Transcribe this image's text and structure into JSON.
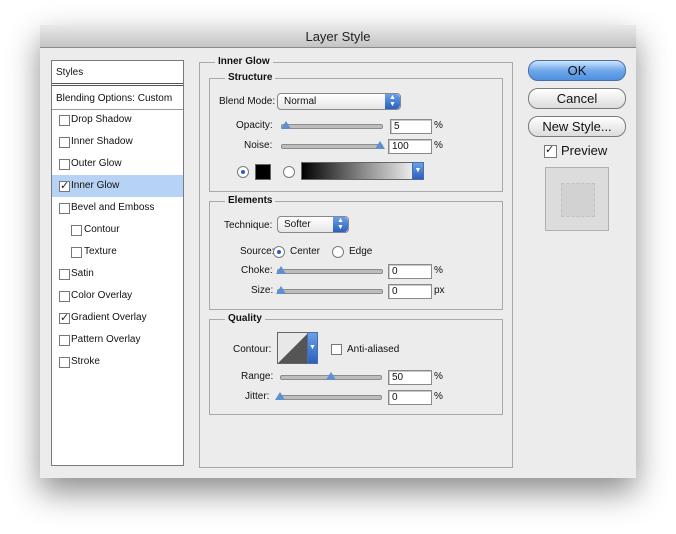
{
  "window": {
    "title": "Layer Style"
  },
  "sidebar": {
    "header": "Styles",
    "blending": "Blending Options: Custom",
    "items": [
      {
        "label": "Drop Shadow",
        "checked": false
      },
      {
        "label": "Inner Shadow",
        "checked": false
      },
      {
        "label": "Outer Glow",
        "checked": false
      },
      {
        "label": "Inner Glow",
        "checked": true,
        "selected": true
      },
      {
        "label": "Bevel and Emboss",
        "checked": false
      },
      {
        "label": "Contour",
        "checked": false
      },
      {
        "label": "Texture",
        "checked": false
      },
      {
        "label": "Satin",
        "checked": false
      },
      {
        "label": "Color Overlay",
        "checked": false
      },
      {
        "label": "Gradient Overlay",
        "checked": true
      },
      {
        "label": "Pattern Overlay",
        "checked": false
      },
      {
        "label": "Stroke",
        "checked": false
      }
    ]
  },
  "panel": {
    "title": "Inner Glow",
    "structure": {
      "title": "Structure",
      "blend_mode_label": "Blend Mode:",
      "blend_mode_value": "Normal",
      "opacity_label": "Opacity:",
      "opacity_value": "5",
      "opacity_unit": "%",
      "noise_label": "Noise:",
      "noise_value": "100",
      "noise_unit": "%",
      "color_swatch": "#000000",
      "color_mode": "solid"
    },
    "elements": {
      "title": "Elements",
      "technique_label": "Technique:",
      "technique_value": "Softer",
      "source_label": "Source:",
      "source_center": "Center",
      "source_edge": "Edge",
      "source_selected": "Center",
      "choke_label": "Choke:",
      "choke_value": "0",
      "choke_unit": "%",
      "size_label": "Size:",
      "size_value": "0",
      "size_unit": "px"
    },
    "quality": {
      "title": "Quality",
      "contour_label": "Contour:",
      "antialiased_label": "Anti-aliased",
      "antialiased_checked": false,
      "range_label": "Range:",
      "range_value": "50",
      "range_unit": "%",
      "jitter_label": "Jitter:",
      "jitter_value": "0",
      "jitter_unit": "%"
    }
  },
  "buttons": {
    "ok": "OK",
    "cancel": "Cancel",
    "new_style": "New Style...",
    "preview_label": "Preview",
    "preview_checked": true
  },
  "colors": {
    "accent": "#4d90e0",
    "selection": "#b6d2f4"
  }
}
